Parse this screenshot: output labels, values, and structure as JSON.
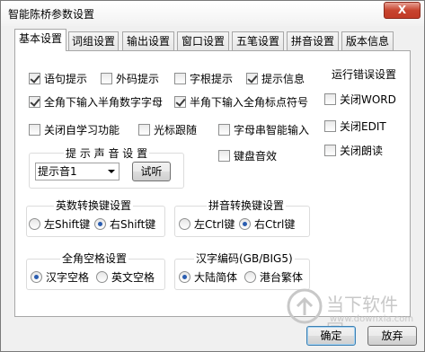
{
  "window": {
    "title": "智能陈桥参数设置",
    "close_label": "X"
  },
  "tabs": [
    "基本设置",
    "词组设置",
    "输出设置",
    "窗口设置",
    "五笔设置",
    "拼音设置",
    "版本信息"
  ],
  "checkboxes": {
    "yujv": "语句提示",
    "waima": "外码提示",
    "zigen": "字根提示",
    "tishi": "提示信息",
    "quanjiao": "全角下输入半角数字字母",
    "banjiao": "半角下输入全角标点符号",
    "zixuexi": "关闭自学习功能",
    "guangbiao": "光标跟随",
    "zimuchuan": "字母串智能输入",
    "jianpan": "键盘音效"
  },
  "sound_group": {
    "label": "提 示 声 音 设 置",
    "selected": "提示音1",
    "listen_button": "试听"
  },
  "yingshu_group": {
    "label": "英数转换键设置",
    "left": "左Shift键",
    "right": "右Shift键"
  },
  "pinyin_group": {
    "label": "拼音转换键设置",
    "left": "左Ctrl键",
    "right": "右Ctrl键"
  },
  "quanjiao_group": {
    "label": "全角空格设置",
    "hanzi": "汉字空格",
    "yingwen": "英文空格"
  },
  "encoding_group": {
    "label": "汉字编码(GB/BIG5)",
    "mainland": "大陆简体",
    "taiwan": "港台繁体"
  },
  "error_group": {
    "label": "运行错误设置",
    "word": "关闭WORD",
    "edit": "关闭EDIT",
    "read": "关闭朗读"
  },
  "buttons": {
    "ok": "确定",
    "cancel": "放弃"
  },
  "watermark": {
    "brand": "当下软件园",
    "url": "www.downxia.com"
  },
  "colors": {
    "accent": "#2a5db0",
    "close": "#c7442e",
    "watermark": "#c8c8c8"
  }
}
